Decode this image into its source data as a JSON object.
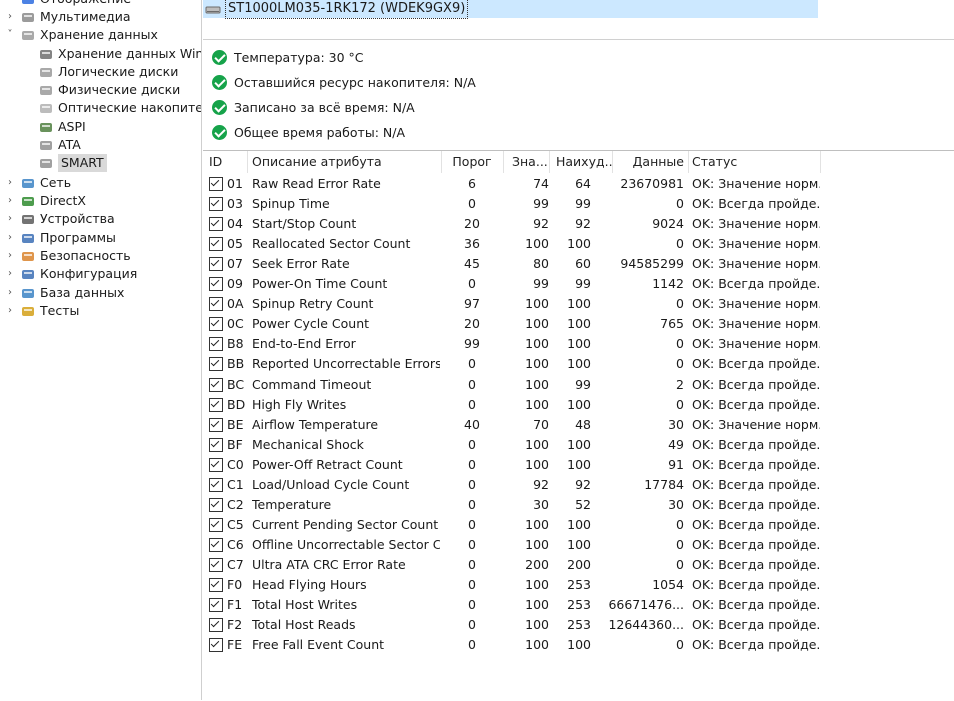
{
  "tree": [
    {
      "label": "Отображение",
      "expander": "",
      "icon": "display-icon"
    },
    {
      "label": "Мультимедиа",
      "expander": "›",
      "icon": "multimedia-icon"
    },
    {
      "label": "Хранение данных",
      "expander": "˅",
      "icon": "storage-icon"
    },
    {
      "label": "Хранение данных Windows",
      "expander": "",
      "icon": "storage-windows-icon"
    },
    {
      "label": "Логические диски",
      "expander": "",
      "icon": "logical-disk-icon"
    },
    {
      "label": "Физические диски",
      "expander": "",
      "icon": "physical-disk-icon"
    },
    {
      "label": "Оптические накопители",
      "expander": "",
      "icon": "optical-drive-icon"
    },
    {
      "label": "ASPI",
      "expander": "",
      "icon": "aspi-icon"
    },
    {
      "label": "ATA",
      "expander": "",
      "icon": "ata-icon"
    },
    {
      "label": "SMART",
      "expander": "",
      "icon": "smart-icon"
    },
    {
      "label": "Сеть",
      "expander": "›",
      "icon": "network-icon"
    },
    {
      "label": "DirectX",
      "expander": "›",
      "icon": "directx-icon"
    },
    {
      "label": "Устройства",
      "expander": "›",
      "icon": "devices-icon"
    },
    {
      "label": "Программы",
      "expander": "›",
      "icon": "programs-icon"
    },
    {
      "label": "Безопасность",
      "expander": "›",
      "icon": "security-icon"
    },
    {
      "label": "Конфигурация",
      "expander": "›",
      "icon": "configuration-icon"
    },
    {
      "label": "База данных",
      "expander": "›",
      "icon": "database-icon"
    },
    {
      "label": "Тесты",
      "expander": "›",
      "icon": "tests-icon"
    }
  ],
  "device": {
    "name": "ST1000LM035-1RK172 (WDEK9GX9)"
  },
  "summary": [
    "Температура: 30 °C",
    "Оставшийся ресурс накопителя: N/A",
    "Записано за всё время: N/A",
    "Общее время работы: N/A"
  ],
  "columns": {
    "id": "ID",
    "desc": "Описание атрибута",
    "threshold": "Порог",
    "value": "Зна...",
    "worst": "Наихуд...",
    "data": "Данные",
    "status": "Статус"
  },
  "rows": [
    {
      "id": "01",
      "desc": "Raw Read Error Rate",
      "threshold": "6",
      "value": "74",
      "worst": "64",
      "data": "23670981",
      "status": "OK: Значение норм..."
    },
    {
      "id": "03",
      "desc": "Spinup Time",
      "threshold": "0",
      "value": "99",
      "worst": "99",
      "data": "0",
      "status": "OK: Всегда пройде..."
    },
    {
      "id": "04",
      "desc": "Start/Stop Count",
      "threshold": "20",
      "value": "92",
      "worst": "92",
      "data": "9024",
      "status": "OK: Значение норм..."
    },
    {
      "id": "05",
      "desc": "Reallocated Sector Count",
      "threshold": "36",
      "value": "100",
      "worst": "100",
      "data": "0",
      "status": "OK: Значение норм..."
    },
    {
      "id": "07",
      "desc": "Seek Error Rate",
      "threshold": "45",
      "value": "80",
      "worst": "60",
      "data": "94585299",
      "status": "OK: Значение норм..."
    },
    {
      "id": "09",
      "desc": "Power-On Time Count",
      "threshold": "0",
      "value": "99",
      "worst": "99",
      "data": "1142",
      "status": "OK: Всегда пройде..."
    },
    {
      "id": "0A",
      "desc": "Spinup Retry Count",
      "threshold": "97",
      "value": "100",
      "worst": "100",
      "data": "0",
      "status": "OK: Значение норм..."
    },
    {
      "id": "0C",
      "desc": "Power Cycle Count",
      "threshold": "20",
      "value": "100",
      "worst": "100",
      "data": "765",
      "status": "OK: Значение норм..."
    },
    {
      "id": "B8",
      "desc": "End-to-End Error",
      "threshold": "99",
      "value": "100",
      "worst": "100",
      "data": "0",
      "status": "OK: Значение норм..."
    },
    {
      "id": "BB",
      "desc": "Reported Uncorrectable Errors",
      "threshold": "0",
      "value": "100",
      "worst": "100",
      "data": "0",
      "status": "OK: Всегда пройде..."
    },
    {
      "id": "BC",
      "desc": "Command Timeout",
      "threshold": "0",
      "value": "100",
      "worst": "99",
      "data": "2",
      "status": "OK: Всегда пройде..."
    },
    {
      "id": "BD",
      "desc": "High Fly Writes",
      "threshold": "0",
      "value": "100",
      "worst": "100",
      "data": "0",
      "status": "OK: Всегда пройде..."
    },
    {
      "id": "BE",
      "desc": "Airflow Temperature",
      "threshold": "40",
      "value": "70",
      "worst": "48",
      "data": "30",
      "status": "OK: Значение норм..."
    },
    {
      "id": "BF",
      "desc": "Mechanical Shock",
      "threshold": "0",
      "value": "100",
      "worst": "100",
      "data": "49",
      "status": "OK: Всегда пройде..."
    },
    {
      "id": "C0",
      "desc": "Power-Off Retract Count",
      "threshold": "0",
      "value": "100",
      "worst": "100",
      "data": "91",
      "status": "OK: Всегда пройде..."
    },
    {
      "id": "C1",
      "desc": "Load/Unload Cycle Count",
      "threshold": "0",
      "value": "92",
      "worst": "92",
      "data": "17784",
      "status": "OK: Всегда пройде..."
    },
    {
      "id": "C2",
      "desc": "Temperature",
      "threshold": "0",
      "value": "30",
      "worst": "52",
      "data": "30",
      "status": "OK: Всегда пройде..."
    },
    {
      "id": "C5",
      "desc": "Current Pending Sector Count",
      "threshold": "0",
      "value": "100",
      "worst": "100",
      "data": "0",
      "status": "OK: Всегда пройде..."
    },
    {
      "id": "C6",
      "desc": "Offline Uncorrectable Sector C...",
      "threshold": "0",
      "value": "100",
      "worst": "100",
      "data": "0",
      "status": "OK: Всегда пройде..."
    },
    {
      "id": "C7",
      "desc": "Ultra ATA CRC Error Rate",
      "threshold": "0",
      "value": "200",
      "worst": "200",
      "data": "0",
      "status": "OK: Всегда пройде..."
    },
    {
      "id": "F0",
      "desc": "Head Flying Hours",
      "threshold": "0",
      "value": "100",
      "worst": "253",
      "data": "1054",
      "status": "OK: Всегда пройде..."
    },
    {
      "id": "F1",
      "desc": "Total Host Writes",
      "threshold": "0",
      "value": "100",
      "worst": "253",
      "data": "66671476...",
      "status": "OK: Всегда пройде..."
    },
    {
      "id": "F2",
      "desc": "Total Host Reads",
      "threshold": "0",
      "value": "100",
      "worst": "253",
      "data": "12644360...",
      "status": "OK: Всегда пройде..."
    },
    {
      "id": "FE",
      "desc": "Free Fall Event Count",
      "threshold": "0",
      "value": "100",
      "worst": "100",
      "data": "0",
      "status": "OK: Всегда пройде..."
    }
  ]
}
